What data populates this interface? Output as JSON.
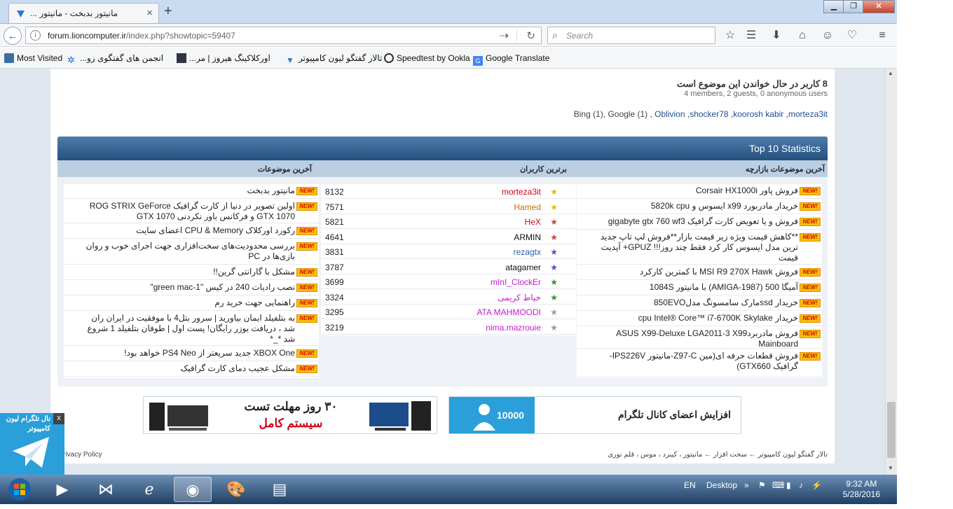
{
  "browser": {
    "tab_title": "... مانیتور بدبخت - مانیتور",
    "url_domain": "forum.lioncomputer.ir",
    "url_path": "/index.php?showtopic=59407",
    "search_placeholder": "Search",
    "bookmarks": [
      "Most Visited",
      "...انجمن های گفتگوی رو",
      "...اورکلاکینگ هیروز | مر",
      "تالار گفتگو لیون کامپیوتر",
      "Speedtest by Ookla",
      "Google Translate"
    ]
  },
  "readers": {
    "title": "8 کاربر در حال خواندن این موضوع است",
    "subtitle": "4 members, 2 guests, 0 anonymous users",
    "list_prefix": "Bing (1), Google (1) ,",
    "names": [
      "Oblivion",
      "shocker78",
      "koorosh kabir",
      "morteza3it"
    ]
  },
  "stats": {
    "title": "Top 10 Statistics",
    "col_market": "آخرین موضوعات بازارچه",
    "col_users": "برترین کاربران",
    "col_topics": "آخرین موضوعات",
    "new_label": "NEW!",
    "market": [
      "فروش پاور Corsair HX1000i",
      "خریدار مادربورد x99 ایسوس و 5820k cpu",
      "فروش و یا تعویض کارت گرافیک gigabyte gtx 760 wf3",
      "**کاهش قیمت ویژه زیر قیمت بازار**فروش لپ تاپ جدید ترین مدل ایسوس کار کرد فقط چند روز!!! GPUZ+ آپدیت قیمت",
      "فروش MSI R9 270X Hawk با کمترین کارکرد",
      "آمیگا 500 (AMIGA-1987) با مانیتور 1084S",
      "خریدار ssdمارک سامسونگ مدل850EVO",
      "خریدار cpu Intel® Core™ i7-6700K Skylake",
      "فروش مادربردASUS X99-Deluxe LGA2011-3 X99 Mainboard",
      "فروش قطعات حرفه ای(مین Z97-C-مانیتور IPS226V-گرافیک GTX660)"
    ],
    "users": [
      {
        "name": "morteza3it",
        "posts": "8132",
        "color": "#d0021b",
        "star": "#e8b800"
      },
      {
        "name": "Hamed",
        "posts": "7571",
        "color": "#c87000",
        "star": "#e8b800"
      },
      {
        "name": "HeX",
        "posts": "5821",
        "color": "#d0021b",
        "star": "#d04040"
      },
      {
        "name": "ARMIN",
        "posts": "4641",
        "color": "#111111",
        "star": "#d04040"
      },
      {
        "name": "rezagtx",
        "posts": "3831",
        "color": "#2a5db0",
        "star": "#5a4fc8"
      },
      {
        "name": "atagamer",
        "posts": "3787",
        "color": "#111111",
        "star": "#5a4fc8"
      },
      {
        "name": "mInI_ClockEr",
        "posts": "3699",
        "color": "#c41bd0",
        "star": "#2a9a2a"
      },
      {
        "name": "خیاط کریمی",
        "posts": "3324",
        "color": "#c41bd0",
        "star": "#2a9a2a"
      },
      {
        "name": "ATA MAHMOODI",
        "posts": "3295",
        "color": "#c41bd0",
        "star": "#9a9a9a"
      },
      {
        "name": "nima.mazrouie",
        "posts": "3219",
        "color": "#c41bd0",
        "star": "#9a9a9a"
      }
    ],
    "topics": [
      "مانیتور بدبخت",
      "اولین تصویر در دنیا از کارت گرافیک ROG STRIX GeForce GTX 1070 و فرکانس باور نکردنی GTX 1070",
      "رکورد اورکلاک CPU & Memory اعضای سایت",
      "بررسی محدودیت‌های سخت‌افزاری جهت اجرای خوب و روان بازی‌ها در PC",
      "مشکل با گارانتی گرین!!",
      "نصب رادیات 240 در کیس \"green mac-1\"",
      "راهنمایی جهت خرید رم",
      "به بتلفیلد ایمان بیاورید | سرور بتل4 با موفقیت در ایران ران شد ، دریافت یوزر رایگان! پست اول | طوفان بتلفیلد 1 شروع شد *_*",
      "XBOX One جدید سریعتر از PS4 Neo خواهد بود!",
      "مشکل عجیب دمای کارت گرافیک"
    ]
  },
  "banners": {
    "left_line1": "۳۰ روز مهلت تست",
    "left_line2": "سیستم کامل",
    "right_text": "افزایش اعضای کانال تلگرام",
    "right_count": "10000"
  },
  "footer": {
    "breadcrumb": "تالار گفتگو لیون کامپیوتر  ←  سخت افزار  ←  مانیتور ، کیبرد ، موس ، قلم نوری",
    "privacy": "rivacy Policy"
  },
  "telegram": {
    "text": "نال تلگرام لیون کامپیوتر",
    "close": "x"
  },
  "taskbar": {
    "lang": "EN",
    "desktop": "Desktop",
    "time": "9:32 AM",
    "date": "5/28/2016"
  }
}
